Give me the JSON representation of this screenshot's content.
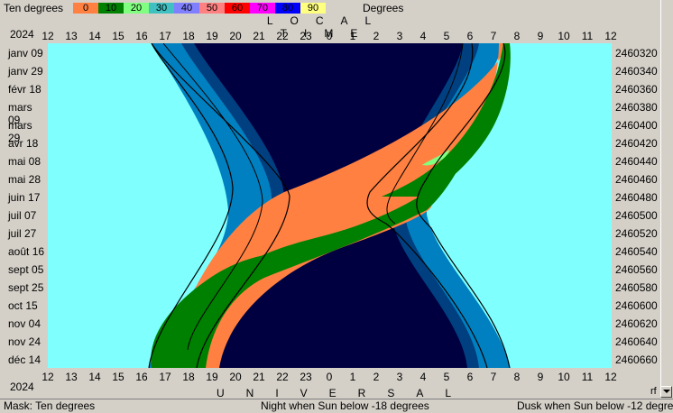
{
  "legend": {
    "title": "Ten degrees",
    "units": "Degrees",
    "items": [
      {
        "label": "0",
        "color": "#ff8040"
      },
      {
        "label": "10",
        "color": "#008000"
      },
      {
        "label": "20",
        "color": "#80ff80"
      },
      {
        "label": "30",
        "color": "#40c0c0"
      },
      {
        "label": "40",
        "color": "#8080ff"
      },
      {
        "label": "50",
        "color": "#ff8080"
      },
      {
        "label": "60",
        "color": "#ff0000"
      },
      {
        "label": "70",
        "color": "#ff00ff"
      },
      {
        "label": "80",
        "color": "#0000ff"
      },
      {
        "label": "90",
        "color": "#ffff80"
      }
    ]
  },
  "header": {
    "top_title": "LOCAL TIME",
    "bottom_title": "UNIVERSAL TIME",
    "year_top": "2024",
    "year_bottom": "2024"
  },
  "hours": [
    "12",
    "13",
    "14",
    "15",
    "16",
    "17",
    "18",
    "19",
    "20",
    "21",
    "22",
    "23",
    "0",
    "1",
    "2",
    "3",
    "4",
    "5",
    "6",
    "7",
    "8",
    "9",
    "10",
    "11",
    "12"
  ],
  "date_labels": [
    "janv 09",
    "janv 29",
    "févr 18",
    "mars 09",
    "mars 29",
    "avr 18",
    "mai 08",
    "mai 28",
    "juin 17",
    "juil 07",
    "juil 27",
    "août 16",
    "sept 05",
    "sept 25",
    "oct 15",
    "nov 04",
    "nov 24",
    "déc 14"
  ],
  "jd_labels": [
    "2460320",
    "2460340",
    "2460360",
    "2460380",
    "2460400",
    "2460420",
    "2460440",
    "2460460",
    "2460480",
    "2460500",
    "2460520",
    "2460540",
    "2460560",
    "2460580",
    "2460600",
    "2460620",
    "2460640",
    "2460660"
  ],
  "colors": {
    "day": "#80ffff",
    "night": "#000040",
    "twilight_civil": "#0080c0",
    "twilight_naut": "#004080",
    "band_low": "#ff8040",
    "band_mid": "#008000",
    "band_high": "#80ff80"
  },
  "status": {
    "mask": "Mask:  Ten degrees",
    "night": "Night when Sun below -18 degrees",
    "dusk": "Dusk when Sun below -12 degrees"
  },
  "corner": "rf"
}
